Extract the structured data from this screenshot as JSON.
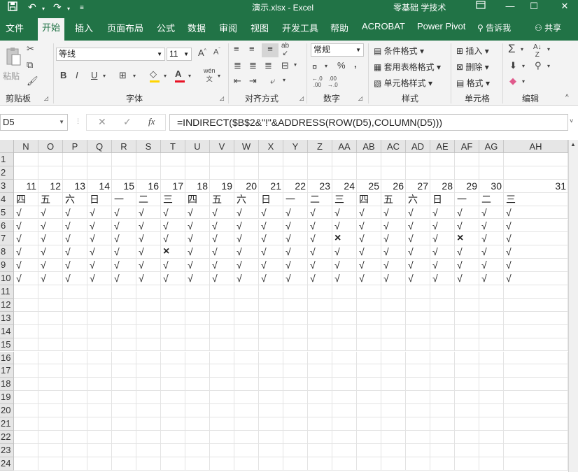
{
  "titlebar": {
    "save_icon": "save-icon",
    "undo_icon": "undo-icon",
    "redo_icon": "redo-icon",
    "customize_icon": "customize-qat-icon",
    "title": "演示.xlsx  -  Excel",
    "user": "零基础 学技术",
    "ribbon_display_icon": "ribbon-display-icon",
    "minimize_icon": "minimize-icon",
    "maximize_icon": "maximize-icon",
    "close_icon": "close-icon",
    "bar_color": "#217346"
  },
  "tabs": {
    "items": [
      "文件",
      "开始",
      "插入",
      "页面布局",
      "公式",
      "数据",
      "审阅",
      "视图",
      "开发工具",
      "帮助",
      "ACROBAT",
      "Power Pivot"
    ],
    "active": "开始",
    "search_label": "告诉我",
    "share_label": "共享"
  },
  "ribbon": {
    "clipboard": {
      "paste": "粘贴",
      "label": "剪贴板"
    },
    "font": {
      "name": "等线",
      "size": "11",
      "bold": "B",
      "italic": "I",
      "underline": "U",
      "label": "字体",
      "wen": "wén"
    },
    "alignment": {
      "label": "对齐方式"
    },
    "number": {
      "format": "常规",
      "percent": "%",
      "comma": ",",
      "label": "数字"
    },
    "styles": {
      "conditional": "条件格式",
      "table": "套用表格格式",
      "cell": "单元格样式",
      "label": "样式"
    },
    "cells": {
      "insert": "插入",
      "delete": "删除",
      "format": "格式",
      "label": "单元格"
    },
    "editing": {
      "label": "编辑"
    }
  },
  "formula_bar": {
    "name_box": "D5",
    "cancel_icon": "cancel-icon",
    "enter_icon": "check-icon",
    "fx_label": "fx",
    "formula": "=INDIRECT($B$2&\"!\"&ADDRESS(ROW(D5),COLUMN(D5)))"
  },
  "sheet": {
    "columns": [
      "N",
      "O",
      "P",
      "Q",
      "R",
      "S",
      "T",
      "U",
      "V",
      "W",
      "X",
      "Y",
      "Z",
      "AA",
      "AB",
      "AC",
      "AD",
      "AE",
      "AF",
      "AG",
      "AH"
    ],
    "rows": [
      "1",
      "2",
      "3",
      "4",
      "5",
      "6",
      "7",
      "8",
      "9",
      "10",
      "11",
      "12",
      "13",
      "14",
      "15",
      "16",
      "17",
      "18",
      "19",
      "20",
      "21",
      "22",
      "23",
      "24"
    ],
    "row3_days": [
      "11",
      "12",
      "13",
      "14",
      "15",
      "16",
      "17",
      "18",
      "19",
      "20",
      "21",
      "22",
      "23",
      "24",
      "25",
      "26",
      "27",
      "28",
      "29",
      "30",
      "31"
    ],
    "row4_weekdays": [
      "四",
      "五",
      "六",
      "日",
      "一",
      "二",
      "三",
      "四",
      "五",
      "六",
      "日",
      "一",
      "二",
      "三",
      "四",
      "五",
      "六",
      "日",
      "一",
      "二",
      "三"
    ],
    "attendance": [
      [
        "√",
        "√",
        "√",
        "√",
        "√",
        "√",
        "√",
        "√",
        "√",
        "√",
        "√",
        "√",
        "√",
        "√",
        "√",
        "√",
        "√",
        "√",
        "√",
        "√",
        "√"
      ],
      [
        "√",
        "√",
        "√",
        "√",
        "√",
        "√",
        "√",
        "√",
        "√",
        "√",
        "√",
        "√",
        "√",
        "√",
        "√",
        "√",
        "√",
        "√",
        "√",
        "√",
        "√"
      ],
      [
        "√",
        "√",
        "√",
        "√",
        "√",
        "√",
        "√",
        "√",
        "√",
        "√",
        "√",
        "√",
        "√",
        "×",
        "√",
        "√",
        "√",
        "√",
        "×",
        "√",
        "√"
      ],
      [
        "√",
        "√",
        "√",
        "√",
        "√",
        "√",
        "×",
        "√",
        "√",
        "√",
        "√",
        "√",
        "√",
        "√",
        "√",
        "√",
        "√",
        "√",
        "√",
        "√",
        "√"
      ],
      [
        "√",
        "√",
        "√",
        "√",
        "√",
        "√",
        "√",
        "√",
        "√",
        "√",
        "√",
        "√",
        "√",
        "√",
        "√",
        "√",
        "√",
        "√",
        "√",
        "√",
        "√"
      ],
      [
        "√",
        "√",
        "√",
        "√",
        "√",
        "√",
        "√",
        "√",
        "√",
        "√",
        "√",
        "√",
        "√",
        "√",
        "√",
        "√",
        "√",
        "√",
        "√",
        "√",
        "√"
      ]
    ]
  }
}
